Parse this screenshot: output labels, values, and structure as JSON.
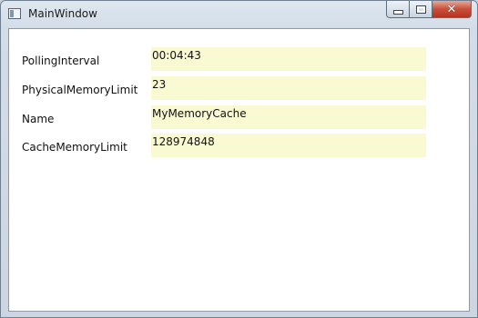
{
  "window": {
    "title": "MainWindow",
    "icon": "window-icon",
    "controls": [
      "minimize-icon",
      "maximize-icon",
      "close-icon"
    ]
  },
  "fields": [
    {
      "label": "PollingInterval",
      "value": "00:04:43"
    },
    {
      "label": "PhysicalMemoryLimit",
      "value": "23"
    },
    {
      "label": "Name",
      "value": "MyMemoryCache"
    },
    {
      "label": "CacheMemoryLimit",
      "value": "128974848"
    }
  ],
  "colors": {
    "value_background": "#fafad2",
    "client_background": "#ffffff",
    "close_button": "#c7503a"
  }
}
